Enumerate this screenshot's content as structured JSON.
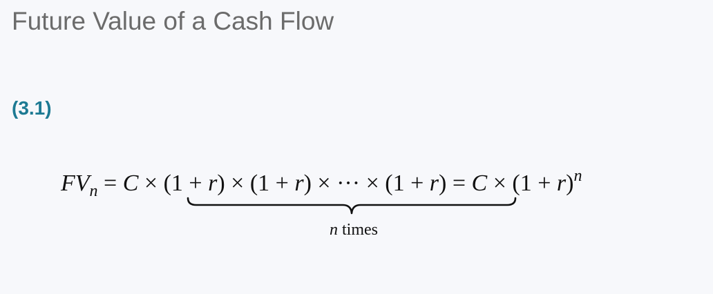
{
  "heading": {
    "title": "Future Value of a Cash Flow"
  },
  "equation": {
    "number": "(3.1)",
    "lhs_symbol": "FV",
    "lhs_subscript": "n",
    "equals": "=",
    "cash_flow": "C",
    "times": "×",
    "factor_open": "(1 + ",
    "rate": "r",
    "factor_close": ")",
    "ellipsis": "···",
    "exponent": "n",
    "brace_count": "n",
    "brace_word": "times"
  }
}
